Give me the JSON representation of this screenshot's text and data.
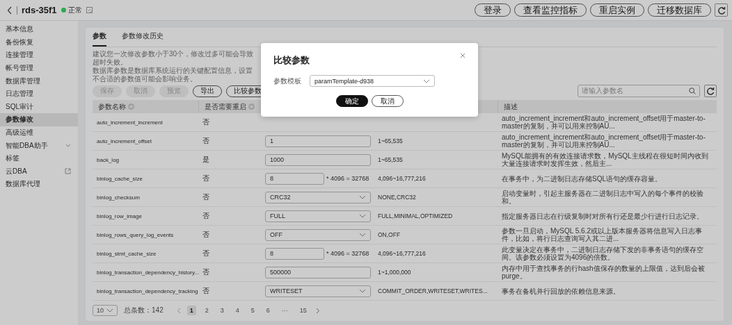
{
  "header": {
    "title": "rds-35f1",
    "status": {
      "label": "正常",
      "color": "#2fa84f"
    },
    "actions": [
      "登录",
      "查看监控指标",
      "重启实例",
      "迁移数据库"
    ]
  },
  "sidebar": {
    "items": [
      {
        "label": "基本信息",
        "kind": "item",
        "selected": false
      },
      {
        "label": "备份恢复",
        "kind": "item",
        "selected": false
      },
      {
        "label": "连接管理",
        "kind": "item",
        "selected": false
      },
      {
        "label": "帐号管理",
        "kind": "item",
        "selected": false
      },
      {
        "label": "数据库管理",
        "kind": "item",
        "selected": false
      },
      {
        "label": "日志管理",
        "kind": "item",
        "selected": false
      },
      {
        "label": "SQL审计",
        "kind": "item",
        "selected": false
      },
      {
        "label": "参数修改",
        "kind": "item",
        "selected": true
      },
      {
        "label": "高级运维",
        "kind": "item",
        "selected": false
      },
      {
        "label": "智能DBA助手",
        "kind": "group",
        "selected": false,
        "expanded": false
      },
      {
        "label": "标签",
        "kind": "item",
        "selected": false
      },
      {
        "label": "云DBA",
        "kind": "external",
        "selected": false
      },
      {
        "label": "数据库代理",
        "kind": "item",
        "selected": false
      }
    ]
  },
  "tabs": [
    {
      "label": "参数",
      "selected": true
    },
    {
      "label": "参数修改历史",
      "selected": false
    }
  ],
  "notices": [
    "建议您一次修改参数小于30个，修改过多可能会导致超时失败。",
    "数据库参数是数据库系统运行的关键配置信息，设置不合适的参数值可能会影响业务。"
  ],
  "toolbar": {
    "buttons": [
      {
        "label": "保存",
        "disabled": true
      },
      {
        "label": "取消",
        "disabled": true
      },
      {
        "label": "预览",
        "disabled": true
      },
      {
        "label": "导出",
        "disabled": false
      },
      {
        "label": "比较参数",
        "disabled": false
      }
    ],
    "search": {
      "placeholder": "请输入参数名"
    }
  },
  "table": {
    "columns": [
      {
        "label": "参数名称",
        "sortable": true
      },
      {
        "label": "是否需要重启",
        "sortable": true
      },
      {
        "label": "描述",
        "sortable": false
      }
    ],
    "rows": [
      {
        "name": "auto_increment_increment",
        "restart": "否",
        "description": "auto_increment_increment和auto_increment_offset用于master-to-master的复制，并可以用来控制AU..."
      },
      {
        "name": "auto_increment_offset",
        "restart": "否",
        "value": {
          "kind": "input",
          "text": "1"
        },
        "range": "1~65,535",
        "description": "auto_increment_increment和auto_increment_offset用于master-to-master的复制，并可以用来控制AU..."
      },
      {
        "name": "back_log",
        "restart": "是",
        "value": {
          "kind": "input",
          "text": "1000"
        },
        "range": "1~65,535",
        "description": "MySQL能拥有的有效连接请求数，MySQL主线程在很短时间内收到大量连接请求时发挥生效，然后主..."
      },
      {
        "name": "binlog_cache_size",
        "restart": "否",
        "value": {
          "kind": "multiplier",
          "text": "8",
          "suffix": "* 4096 = 32768"
        },
        "range": "4,096~16,777,216",
        "description": "在事务中，为二进制日志存储SQL语句的缓存容量。"
      },
      {
        "name": "binlog_checksum",
        "restart": "否",
        "value": {
          "kind": "select",
          "text": "CRC32"
        },
        "range": "NONE,CRC32",
        "description": "启动变量时，引起主服务器在二进制日志中写入的每个事件的校验和。"
      },
      {
        "name": "binlog_row_image",
        "restart": "否",
        "value": {
          "kind": "select",
          "text": "FULL"
        },
        "range": "FULL,MINIMAL,OPTIMIZED",
        "description": "指定服务器日志在行级复制时对所有行还是最少行进行日志记录。"
      },
      {
        "name": "binlog_rows_query_log_events",
        "restart": "否",
        "value": {
          "kind": "select",
          "text": "OFF"
        },
        "range": "ON,OFF",
        "description": "参数一旦启动，MySQL 5.6.2或以上版本服务器将信息写入日志事件，比如，将行日志查询写入其二进..."
      },
      {
        "name": "binlog_stmt_cache_size",
        "restart": "否",
        "value": {
          "kind": "multiplier",
          "text": "8",
          "suffix": "* 4096 = 32768"
        },
        "range": "4,096~16,777,216",
        "description": "此变量决定在事务中，二进制日志存储下发的非事务语句的缓存空间。该参数必须设置为4096的倍数。"
      },
      {
        "name": "binlog_transaction_dependency_history...",
        "restart": "否",
        "value": {
          "kind": "input",
          "text": "500000"
        },
        "range": "1~1,000,000",
        "description": "内存中用于查找事务的行hash值保存的数量的上限值，达到后会被purge。"
      },
      {
        "name": "binlog_transaction_dependency_tracking",
        "restart": "否",
        "value": {
          "kind": "select",
          "text": "WRITESET"
        },
        "range": "COMMIT_ORDER,WRITESET,WRITES...",
        "description": "事务在备机并行回放的依赖信息来源。"
      }
    ]
  },
  "pagination": {
    "page_size": "10",
    "total": "总条数：142",
    "pages": [
      {
        "label": "1",
        "selected": true
      },
      {
        "label": "2",
        "selected": false
      },
      {
        "label": "3",
        "selected": false
      },
      {
        "label": "4",
        "selected": false
      },
      {
        "label": "5",
        "selected": false
      },
      {
        "label": "6",
        "selected": false
      },
      {
        "label": "···",
        "selected": false
      },
      {
        "label": "15",
        "selected": false
      }
    ]
  },
  "dialog": {
    "title": "比较参数",
    "field": {
      "label": "参数模板",
      "value": "paramTemplate-d938"
    },
    "buttons": [
      {
        "label": "确定",
        "primary": true
      },
      {
        "label": "取消",
        "primary": false
      }
    ]
  }
}
